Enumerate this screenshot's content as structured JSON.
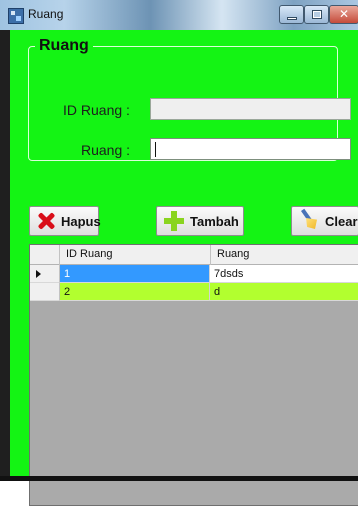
{
  "window": {
    "title": "Ruang"
  },
  "form": {
    "group_title": "Ruang",
    "id_label": "ID Ruang :",
    "id_value": "",
    "ruang_label": "Ruang :",
    "ruang_value": ""
  },
  "buttons": {
    "hapus": "Hapus",
    "tambah": "Tambah",
    "clear": "Clear"
  },
  "grid": {
    "headers": [
      "ID Ruang",
      "Ruang"
    ],
    "rows": [
      {
        "id": "1",
        "ruang": "7dsds"
      },
      {
        "id": "2",
        "ruang": "d"
      }
    ]
  },
  "icons": {
    "app": "app-icon",
    "delete": "delete-icon",
    "add": "add-icon",
    "clear": "broom-icon"
  },
  "colors": {
    "background": "#14f414",
    "selected_cell": "#3399ff",
    "highlight_row": "#b2ff2f"
  }
}
